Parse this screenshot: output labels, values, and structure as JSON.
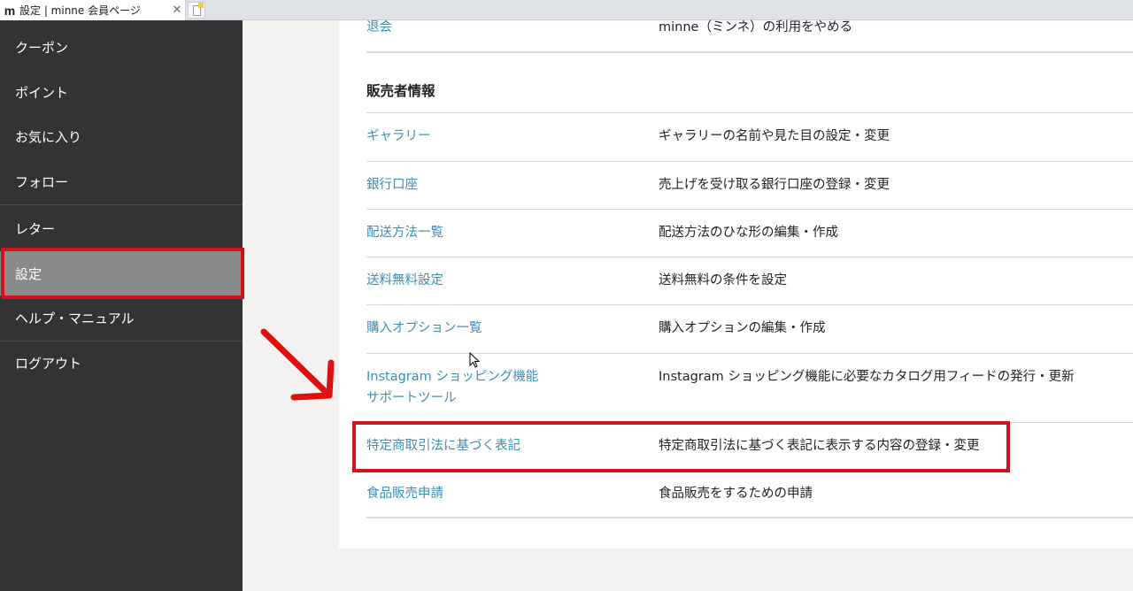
{
  "tab": {
    "favicon": "m",
    "title": "設定 | minne 会員ページ",
    "close": "✕"
  },
  "sidebar": {
    "items": [
      {
        "label": "クーポン"
      },
      {
        "label": "ポイント"
      },
      {
        "label": "お気に入り"
      },
      {
        "label": "フォロー"
      },
      {
        "label": "レター"
      },
      {
        "label": "設定",
        "active": true
      },
      {
        "label": "ヘルプ・マニュアル"
      },
      {
        "label": "ログアウト"
      }
    ]
  },
  "main": {
    "top_row": {
      "key": "退会",
      "value": "minne（ミンネ）の利用をやめる"
    },
    "section_title": "販売者情報",
    "rows": [
      {
        "key": "ギャラリー",
        "value": "ギャラリーの名前や見た目の設定・変更"
      },
      {
        "key": "銀行口座",
        "value": "売上げを受け取る銀行口座の登録・変更"
      },
      {
        "key": "配送方法一覧",
        "value": "配送方法のひな形の編集・作成"
      },
      {
        "key": "送料無料設定",
        "value": "送料無料の条件を設定"
      },
      {
        "key": "購入オプション一覧",
        "value": "購入オプションの編集・作成"
      },
      {
        "key": "Instagram ショッピング機能",
        "key2": "サポートツール",
        "value": "Instagram ショッピング機能に必要なカタログ用フィードの発行・更新"
      },
      {
        "key": "特定商取引法に基づく表記",
        "value": "特定商取引法に基づく表記に表示する内容の登録・変更"
      },
      {
        "key": "食品販売申請",
        "value": "食品販売をするための申請"
      }
    ]
  },
  "colors": {
    "sidebar_bg": "#333333",
    "active_bg": "#8a8a8a",
    "link": "#3a8fb7",
    "annotation_red": "#d0121b"
  }
}
